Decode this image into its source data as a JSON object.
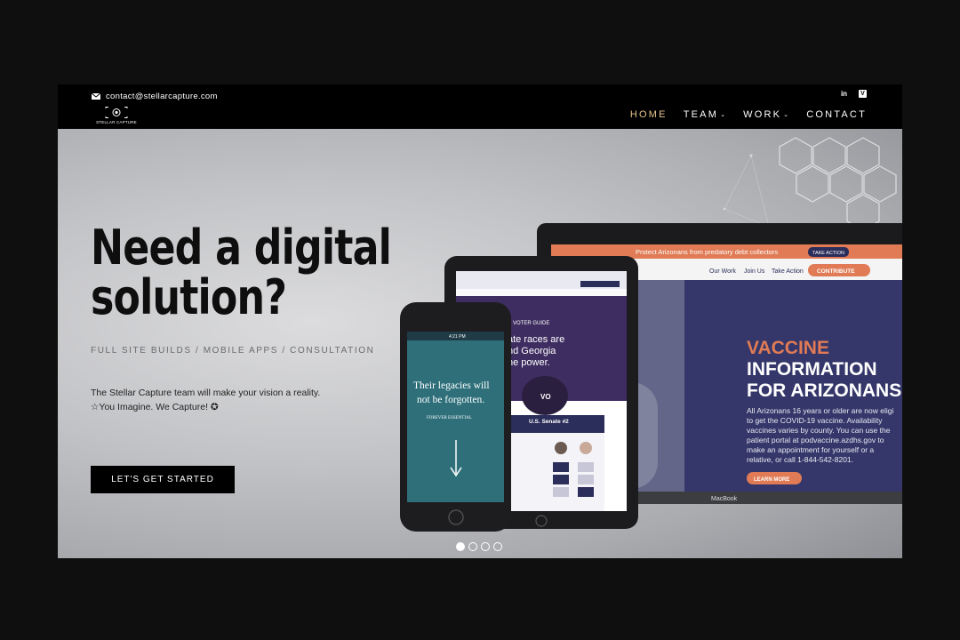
{
  "header": {
    "email": "contact@stellarcapture.com",
    "logo_text": "STELLAR CAPTURE",
    "social": {
      "linkedin_label": "in",
      "vimeo_label": "V"
    },
    "nav": [
      {
        "label": "HOME",
        "active": true,
        "dropdown": false
      },
      {
        "label": "TEAM",
        "active": false,
        "dropdown": true
      },
      {
        "label": "WORK",
        "active": false,
        "dropdown": true
      },
      {
        "label": "CONTACT",
        "active": false,
        "dropdown": false
      }
    ],
    "active_color": "#e7c58f"
  },
  "hero": {
    "headline_line1": "Need a digital",
    "headline_line2": "solution?",
    "subline": "FULL SITE BUILDS / MOBILE APPS / CONSULTATION",
    "body_line1": "The Stellar Capture team will make your vision a reality.",
    "body_line2": "☆You Imagine. We Capture! ✪",
    "cta_label": "LET'S GET STARTED"
  },
  "laptop": {
    "banner": "Protect Arizonans from predatory debt collectors",
    "banner_button": "TAKE ACTION",
    "nav": [
      "Our Work",
      "Join Us",
      "Take Action"
    ],
    "contribute": "CONTRIBUTE",
    "title_line1": "VACCINE",
    "title_line2": "INFORMATION",
    "title_line3": "FOR ARIZONANS",
    "body": [
      "All Arizonans 16 years or older are now eligi",
      "to get the COVID-19 vaccine. Availability",
      "vaccines varies by county. You can use the",
      "patient portal at podvaccine.azdhs.gov to",
      "make an appointment for yourself or a",
      "relative, or call 1-844-542-8201."
    ],
    "learn_more": "LEARN MORE",
    "brand": "MacBook"
  },
  "tablet": {
    "text_lines": [
      "ate races are",
      "nd Georgia",
      "he power."
    ],
    "guide": "VOTER GUIDE",
    "senate": "U.S. Senate #2",
    "vo": "VO"
  },
  "phone": {
    "status": "4:21 PM",
    "quote_line1": "Their legacies will",
    "quote_line2": "not be forgotten.",
    "tag": "FOREVER ESSENTIAL"
  },
  "slider": {
    "count": 4,
    "active_index": 0
  }
}
